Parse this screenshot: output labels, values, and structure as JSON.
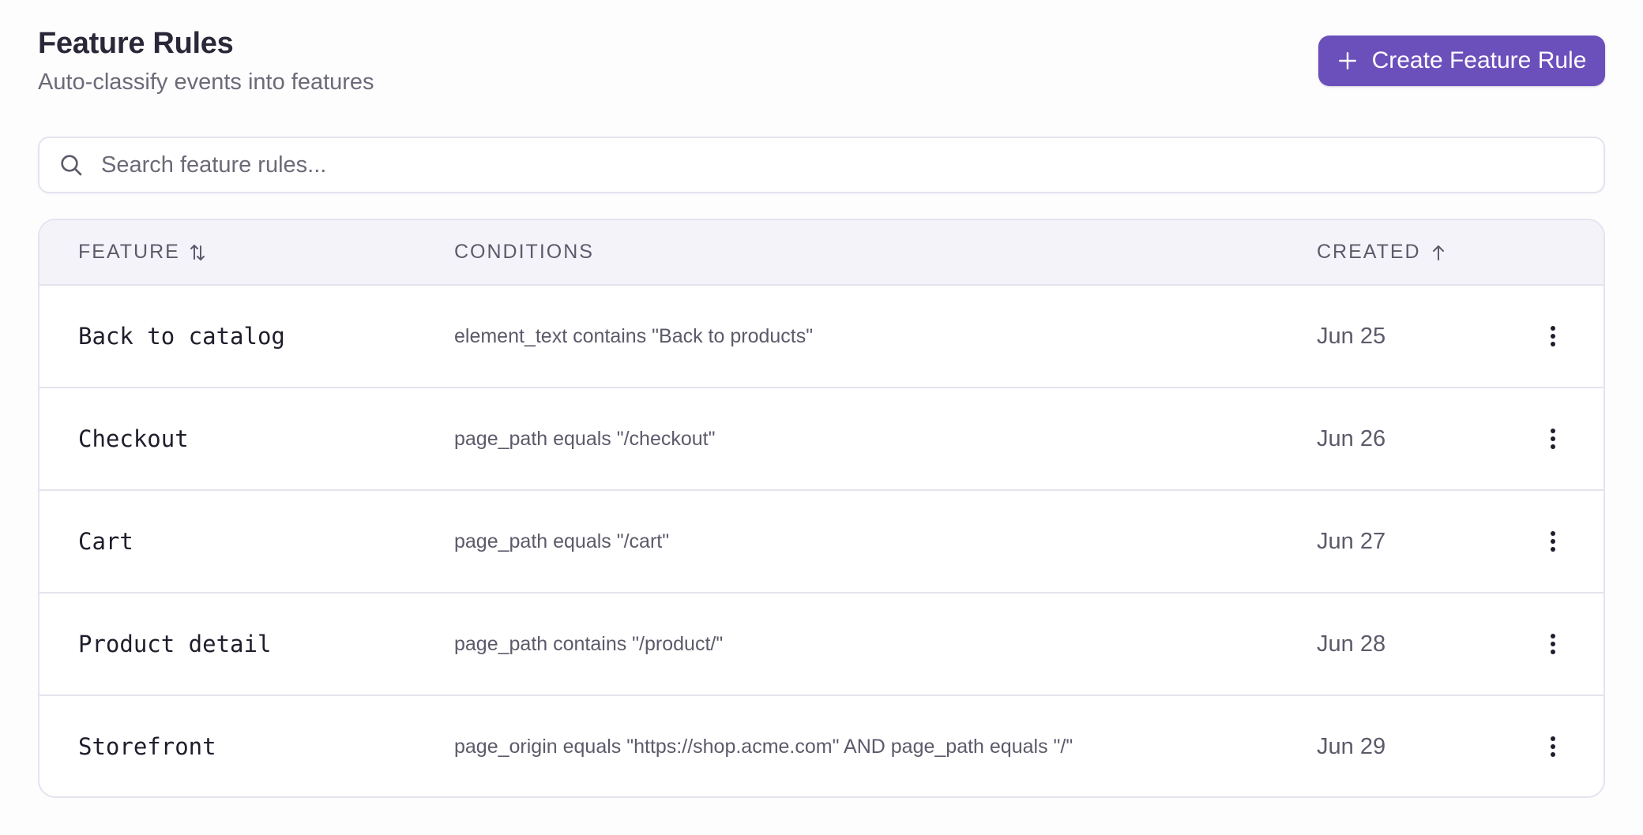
{
  "header": {
    "title": "Feature Rules",
    "subtitle": "Auto-classify events into features",
    "create_button_label": "Create Feature Rule"
  },
  "search": {
    "placeholder": "Search feature rules...",
    "value": ""
  },
  "table": {
    "columns": {
      "feature": "FEATURE",
      "conditions": "CONDITIONS",
      "created": "CREATED"
    },
    "sort": {
      "column": "created",
      "direction": "ascending"
    },
    "rows": [
      {
        "feature": "Back to catalog",
        "conditions": "element_text contains \"Back to products\"",
        "created": "Jun 25"
      },
      {
        "feature": "Checkout",
        "conditions": "page_path equals \"/checkout\"",
        "created": "Jun 26"
      },
      {
        "feature": "Cart",
        "conditions": "page_path equals \"/cart\"",
        "created": "Jun 27"
      },
      {
        "feature": "Product detail",
        "conditions": "page_path contains \"/product/\"",
        "created": "Jun 28"
      },
      {
        "feature": "Storefront",
        "conditions": "page_origin equals \"https://shop.acme.com\" AND page_path equals \"/\"",
        "created": "Jun 29"
      }
    ]
  },
  "colors": {
    "accent": "#6b4fbb",
    "header_bg": "#f5f3fa",
    "border": "#e6e3ef",
    "text_primary": "#2a2838",
    "text_muted": "#6c6a78"
  },
  "icons": {
    "create": "plus-icon",
    "search": "search-icon",
    "feature_sort": "sort-both-icon",
    "created_sort": "arrow-up-icon",
    "row_actions": "more-vertical-icon"
  }
}
